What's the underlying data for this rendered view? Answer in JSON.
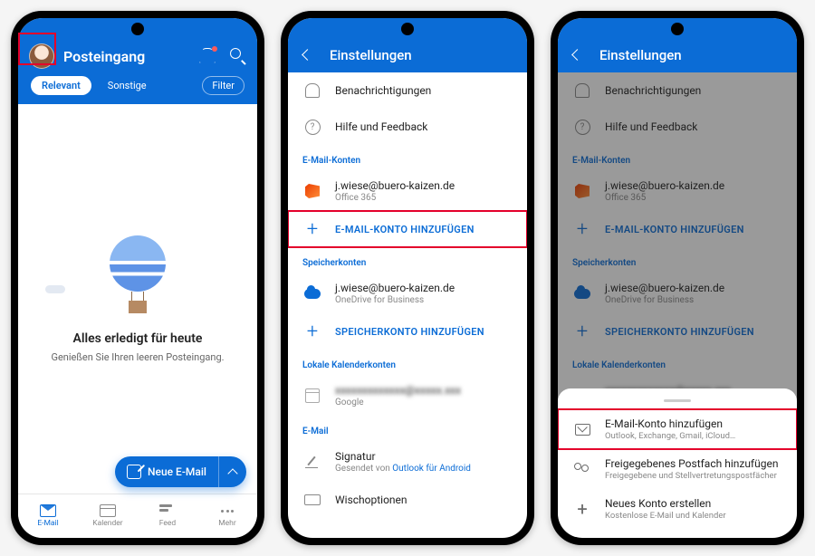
{
  "phone1": {
    "header": {
      "title": "Posteingang"
    },
    "tabs": {
      "relevant": "Relevant",
      "sonstige": "Sonstige",
      "filter": "Filter"
    },
    "empty": {
      "title": "Alles erledigt für heute",
      "subtitle": "Genießen Sie Ihren leeren Posteingang."
    },
    "fab": {
      "label": "Neue E-Mail"
    },
    "tabbar": {
      "mail": "E-Mail",
      "calendar": "Kalender",
      "feed": "Feed",
      "more": "Mehr"
    }
  },
  "phone2": {
    "header": {
      "title": "Einstellungen"
    },
    "items": {
      "notifications": "Benachrichtigungen",
      "help": "Hilfe und Feedback",
      "sec_email": "E-Mail-Konten",
      "acct1_line1": "j.wiese@buero-kaizen.de",
      "acct1_line2": "Office 365",
      "add_email": "E-MAIL-KONTO HINZUFÜGEN",
      "sec_storage": "Speicherkonten",
      "store1_line1": "j.wiese@buero-kaizen.de",
      "store1_line2": "OneDrive for Business",
      "add_storage": "SPEICHERKONTO HINZUFÜGEN",
      "sec_local": "Lokale Kalenderkonten",
      "local_line2": "Google",
      "sec_mail": "E-Mail",
      "sig_line1": "Signatur",
      "sig_prefix": "Gesendet von ",
      "sig_link": "Outlook für Android",
      "swipe": "Wischoptionen"
    }
  },
  "phone3": {
    "header": {
      "title": "Einstellungen"
    },
    "sheet": {
      "opt1_line1": "E-Mail-Konto hinzufügen",
      "opt1_line2": "Outlook, Exchange, Gmail, iCloud…",
      "opt2_line1": "Freigegebenes Postfach hinzufügen",
      "opt2_line2": "Freigegebene und Stellvertretungspostfächer",
      "opt3_line1": "Neues Konto erstellen",
      "opt3_line2": "Kostenlose E-Mail und Kalender"
    }
  }
}
